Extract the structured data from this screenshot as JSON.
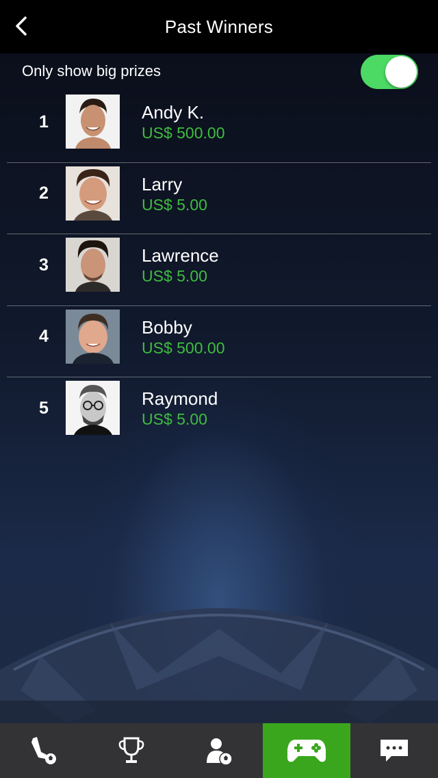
{
  "header": {
    "title": "Past Winners"
  },
  "filter": {
    "label": "Only show big prizes",
    "enabled": true
  },
  "winners": [
    {
      "rank": "1",
      "name": "Andy K.",
      "prize": "US$ 500.00"
    },
    {
      "rank": "2",
      "name": "Larry",
      "prize": "US$ 5.00"
    },
    {
      "rank": "3",
      "name": "Lawrence",
      "prize": "US$ 5.00"
    },
    {
      "rank": "4",
      "name": "Bobby",
      "prize": "US$ 500.00"
    },
    {
      "rank": "5",
      "name": "Raymond",
      "prize": "US$ 5.00"
    }
  ],
  "tabs": [
    {
      "icon": "kick-icon",
      "active": false
    },
    {
      "icon": "trophy-icon",
      "active": false
    },
    {
      "icon": "player-icon",
      "active": false
    },
    {
      "icon": "gamepad-icon",
      "active": true
    },
    {
      "icon": "chat-icon",
      "active": false
    }
  ],
  "colors": {
    "accent": "#3aa61e",
    "prize": "#3fbd3f",
    "toggle": "#4cd964"
  }
}
